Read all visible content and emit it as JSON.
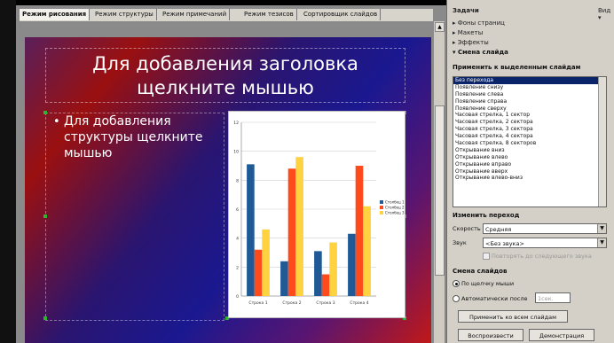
{
  "tabs": [
    "Режим рисования",
    "Режим структуры",
    "Режим примечаний",
    "Режим тезисов",
    "Сортировщик слайдов"
  ],
  "slide": {
    "title": "Для добавления заголовка щелкните мышью",
    "body": "Для добавления структуры щелкните мышью",
    "bullet": "•"
  },
  "chart_data": {
    "type": "bar",
    "categories": [
      "Строка 1",
      "Строка 2",
      "Строка 3",
      "Строка 4"
    ],
    "series": [
      {
        "name": "Столбец 1",
        "values": [
          9.1,
          2.4,
          3.1,
          4.3
        ],
        "color": "#1f5a96"
      },
      {
        "name": "Столбец 2",
        "values": [
          3.2,
          8.8,
          1.5,
          9.0
        ],
        "color": "#ff4a1c"
      },
      {
        "name": "Столбец 3",
        "values": [
          4.6,
          9.6,
          3.7,
          6.2
        ],
        "color": "#ffd23f"
      }
    ],
    "yticks": [
      "0",
      "2",
      "4",
      "6",
      "8",
      "10",
      "12"
    ],
    "ylim": [
      0,
      12
    ],
    "grid": true,
    "legend": "right"
  },
  "panel": {
    "title": "Задачи",
    "view": "Вид ▾",
    "items": [
      "Фоны страниц",
      "Макеты",
      "Эффекты"
    ],
    "expanded": "Смена слайда",
    "apply_label": "Применить к выделенным слайдам",
    "transitions": [
      "Без перехода",
      "Появление снизу",
      "Появление слева",
      "Появление справа",
      "Появление сверху",
      "Часовая стрелка, 1 сектор",
      "Часовая стрелка, 2 сектора",
      "Часовая стрелка, 3 сектора",
      "Часовая стрелка, 4 сектора",
      "Часовая стрелка, 8 секторов",
      "Открывание вниз",
      "Открывание влево",
      "Открывание вправо",
      "Открывание вверх",
      "Открывание влево-вниз"
    ],
    "modify_label": "Изменить переход",
    "speed_label": "Скорость",
    "speed_value": "Средняя",
    "sound_label": "Звук",
    "sound_value": "<Без звука>",
    "repeat_label": "Повторять до следующего звука",
    "advance_label": "Смена слайдов",
    "on_click_label": "По щелчку мыши",
    "auto_label": "Автоматически после",
    "auto_value": "1сек.",
    "apply_all": "Применить ко всем слайдам",
    "play": "Воспроизвести",
    "demo": "Демонстрация"
  }
}
